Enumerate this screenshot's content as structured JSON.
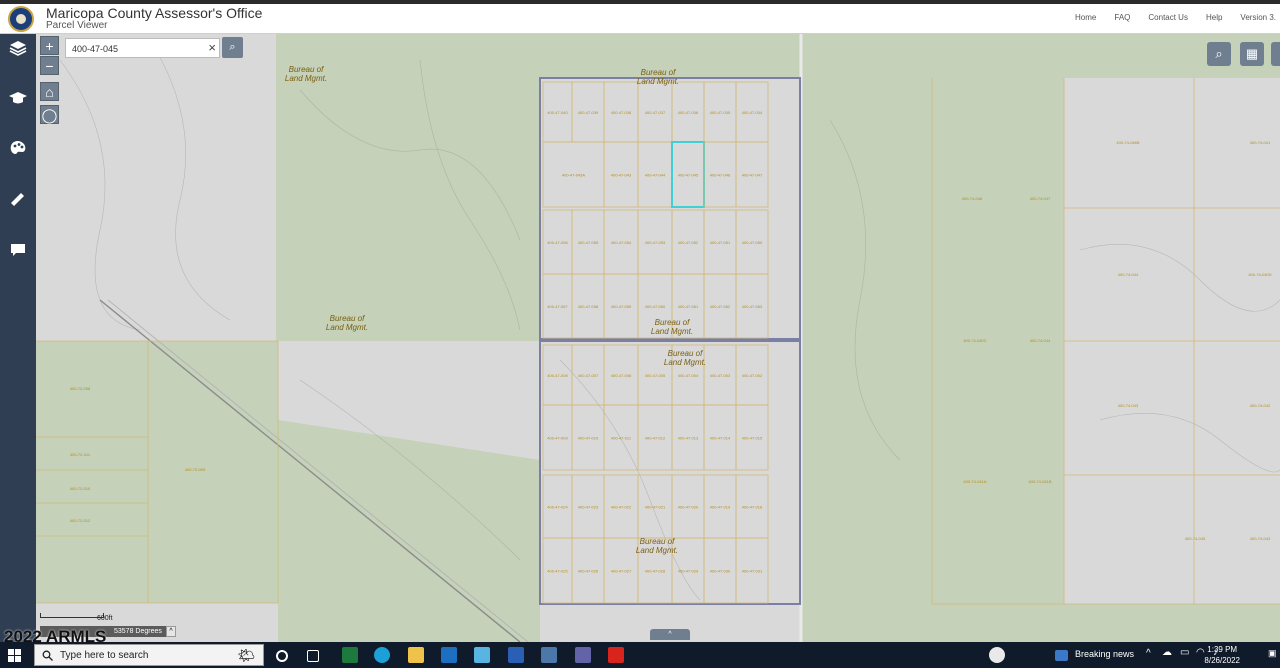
{
  "header": {
    "title": "Maricopa County Assessor's Office",
    "subtitle": "Parcel Viewer",
    "nav": [
      "Home",
      "FAQ",
      "Contact Us",
      "Help",
      "Version 3."
    ]
  },
  "sidebar": {
    "items": [
      {
        "icon": "layers-icon"
      },
      {
        "icon": "graduation-cap-icon"
      },
      {
        "icon": "palette-icon"
      },
      {
        "icon": "ruler-icon"
      },
      {
        "icon": "comment-icon"
      }
    ]
  },
  "map_controls": {
    "zoom_in": "+",
    "zoom_out": "−",
    "home_icon": "⌂",
    "locate_icon": "◯"
  },
  "search": {
    "value": "400-47-045",
    "clear_label": "×",
    "button_icon": "⌕"
  },
  "tools": {
    "search_icon": "⌕",
    "basemap_icon": "▦"
  },
  "map": {
    "landowner_labels": [
      [
        "Bureau of",
        "Land Mgmt."
      ],
      [
        "Bureau of",
        "Land Mgmt."
      ],
      [
        "Bureau of",
        "Land Mgmt."
      ],
      [
        "Bureau of",
        "Land Mgmt."
      ],
      [
        "Bureau of",
        "Land Mgmt."
      ],
      [
        "Bureau of",
        "Land Mgmt."
      ]
    ],
    "north_block_parcels": [
      [
        "400-47-040",
        "400-47-039",
        "400-47-038",
        "400-47-037",
        "400-47-036",
        "400-47-035",
        "400-47-034"
      ],
      [
        "400-47-043A",
        "400-47-043",
        "400-47-044",
        "400-47-045",
        "400-47-046",
        "400-47-047"
      ],
      [
        "400-47-056",
        "400-47-055",
        "400-47-054",
        "400-47-053",
        "400-47-052",
        "400-47-051",
        "400-47-050"
      ],
      [
        "400-47-057",
        "400-47-058",
        "400-47-059",
        "400-47-060",
        "400-47-061",
        "400-47-062",
        "400-47-063"
      ]
    ],
    "south_block_parcels": [
      [
        "400-47-008",
        "400-47-007",
        "400-47-006",
        "400-47-005",
        "400-47-004",
        "400-47-003",
        "400-47-002"
      ],
      [
        "400-47-009",
        "400-47-010",
        "400-47-011",
        "400-47-012",
        "400-47-013",
        "400-47-014",
        "400-47-015"
      ],
      [
        "400-47-024",
        "400-47-023",
        "400-47-022",
        "400-47-021",
        "400-47-020",
        "400-47-019",
        "400-47-018"
      ],
      [
        "400-47-025",
        "400-47-026",
        "400-47-027",
        "400-47-028",
        "400-47-029",
        "400-47-030",
        "400-47-031"
      ]
    ],
    "west_parcels": [
      "400-72-008",
      "400-72-011",
      "400-72-010",
      "400-72-009",
      "400-72-012"
    ],
    "east_parcels": [
      "400-74-046",
      "400-74-047",
      "400-74-046B",
      "400-74-041",
      "400-74-044",
      "400-74-040D",
      "400-74-040C",
      "400-74-044",
      "400-74-043",
      "400-74-042",
      "400-74-041A",
      "400-74-041B",
      "400-74-045",
      "400-74-043"
    ],
    "selected_parcel": "400-47-045"
  },
  "scale": {
    "label": "600ft",
    "coordinates": "53578 Degrees",
    "toggle": "^"
  },
  "watermark": "2022 ARMLS",
  "expand_tab": "^",
  "taskbar": {
    "search_placeholder": "Type here to search",
    "news": "Breaking news",
    "time": "1:39 PM",
    "date": "8/26/2022"
  },
  "colors": {
    "sidebar": "#2f3e53",
    "map_private": "#d9d9d9",
    "map_blm": "#c5d1b8",
    "parcel_line": "#d3b978",
    "parcel_label": "#b38e1e",
    "block_outline": "#7b7fa4",
    "selected": "#3fd0d4",
    "taskbar": "#0f1b2a"
  }
}
